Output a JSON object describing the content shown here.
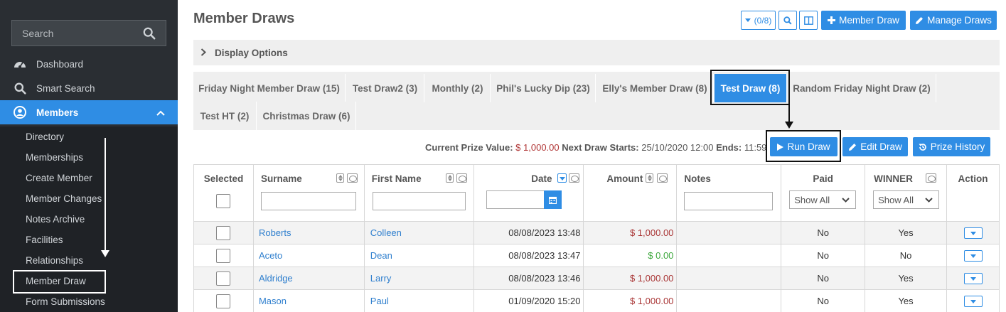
{
  "sidebar": {
    "search_placeholder": "Search",
    "nav": [
      {
        "label": "Dashboard",
        "icon": "dashboard-icon"
      },
      {
        "label": "Smart Search",
        "icon": "search-icon"
      },
      {
        "label": "Members",
        "icon": "user-circle-icon"
      }
    ],
    "sub_items": [
      "Directory",
      "Memberships",
      "Create Member",
      "Member Changes",
      "Notes Archive",
      "Facilities",
      "Relationships",
      "Member Draw",
      "Form Submissions"
    ]
  },
  "header": {
    "title": "Member Draws",
    "filter_count": "(0/8)",
    "add_member_draw": "Member Draw",
    "manage_draws": "Manage Draws"
  },
  "display_options": "Display Options",
  "tabs": [
    "Friday Night Member Draw (15)",
    "Test Draw2 (3)",
    "Monthly (2)",
    "Phil's Lucky Dip (23)",
    "Elly's Member Draw (8)",
    "Test Draw (8)",
    "Random Friday Night Draw (2)",
    "Test HT (2)",
    "Christmas Draw (6)"
  ],
  "active_tab": "Test Draw (8)",
  "draw_info": {
    "prize_label": "Current Prize Value:",
    "prize_value": "$ 1,000.00",
    "next_label": "Next Draw Starts:",
    "next_value": "25/10/2020 12:00",
    "ends_label": "Ends:",
    "ends_value": "11:59",
    "run_draw": "Run Draw",
    "edit_draw": "Edit Draw",
    "prize_history": "Prize History"
  },
  "table": {
    "headers": {
      "selected": "Selected",
      "surname": "Surname",
      "first_name": "First Name",
      "date": "Date",
      "amount": "Amount",
      "notes": "Notes",
      "paid": "Paid",
      "winner": "WINNER",
      "action": "Action"
    },
    "paid_filter": "Show All",
    "winner_filter": "Show All",
    "rows": [
      {
        "surname": "Roberts",
        "first_name": "Colleen",
        "date": "08/08/2023 13:48",
        "amount": "$ 1,000.00",
        "amount_color": "red",
        "notes": "",
        "paid": "No",
        "winner": "Yes"
      },
      {
        "surname": "Aceto",
        "first_name": "Dean",
        "date": "08/08/2023 13:47",
        "amount": "$ 0.00",
        "amount_color": "green",
        "notes": "",
        "paid": "No",
        "winner": "No"
      },
      {
        "surname": "Aldridge",
        "first_name": "Larry",
        "date": "08/08/2023 13:46",
        "amount": "$ 1,000.00",
        "amount_color": "red",
        "notes": "",
        "paid": "No",
        "winner": "Yes"
      },
      {
        "surname": "Mason",
        "first_name": "Paul",
        "date": "01/09/2020 15:20",
        "amount": "$ 1,000.00",
        "amount_color": "red",
        "notes": "",
        "paid": "No",
        "winner": "Yes"
      }
    ]
  },
  "colors": {
    "accent": "#2f8de4",
    "sidebar": "#2a2e33",
    "price": "#b03535",
    "green": "#3aa63a"
  }
}
